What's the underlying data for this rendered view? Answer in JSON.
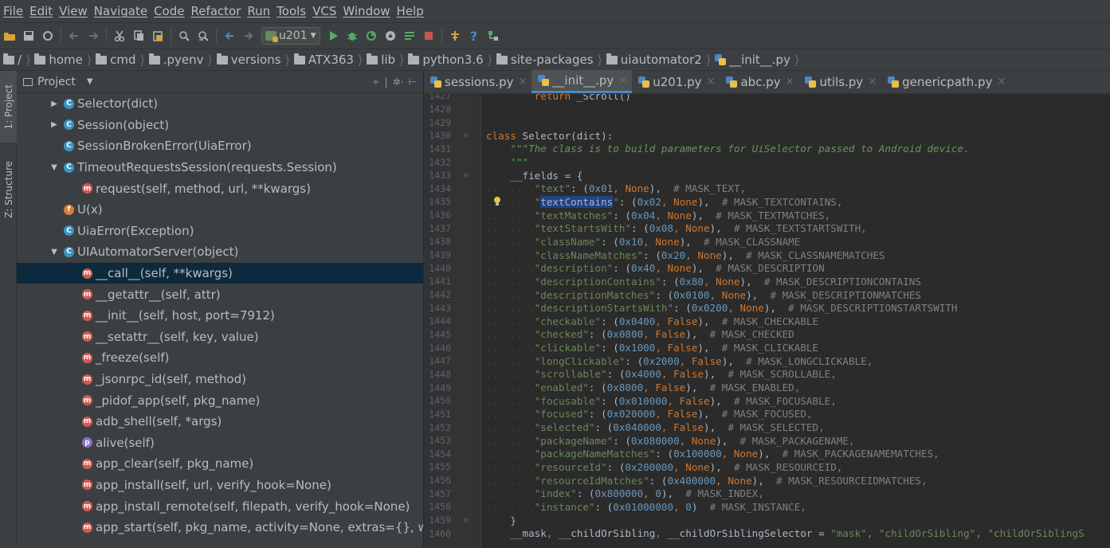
{
  "menu": [
    "File",
    "Edit",
    "View",
    "Navigate",
    "Code",
    "Refactor",
    "Run",
    "Tools",
    "VCS",
    "Window",
    "Help"
  ],
  "toolbar": {
    "run_config": "u201"
  },
  "breadcrumb": [
    "/",
    "home",
    "cmd",
    ".pyenv",
    "versions",
    "ATX363",
    "lib",
    "python3.6",
    "site-packages",
    "uiautomator2",
    "__init__.py"
  ],
  "toolstrip": {
    "project_tab": "1: Project",
    "structure_tab": "Z: Structure"
  },
  "project": {
    "title": "Project",
    "items": [
      {
        "indent": 1,
        "arrow": "▶",
        "kind": "c",
        "badge": "C",
        "label": "Selector(dict)"
      },
      {
        "indent": 1,
        "arrow": "▶",
        "kind": "c",
        "badge": "C",
        "label": "Session(object)"
      },
      {
        "indent": 1,
        "arrow": "",
        "kind": "c",
        "badge": "C",
        "label": "SessionBrokenError(UiaError)"
      },
      {
        "indent": 1,
        "arrow": "▼",
        "kind": "c",
        "badge": "C",
        "label": "TimeoutRequestsSession(requests.Session)"
      },
      {
        "indent": 2,
        "arrow": "",
        "kind": "m",
        "badge": "m",
        "label": "request(self, method, url, **kwargs)"
      },
      {
        "indent": 1,
        "arrow": "",
        "kind": "f",
        "badge": "f",
        "label": "U(x)"
      },
      {
        "indent": 1,
        "arrow": "",
        "kind": "c",
        "badge": "C",
        "label": "UiaError(Exception)"
      },
      {
        "indent": 1,
        "arrow": "▼",
        "kind": "c",
        "badge": "C",
        "label": "UIAutomatorServer(object)"
      },
      {
        "indent": 2,
        "arrow": "",
        "kind": "m",
        "badge": "m",
        "label": "__call__(self, **kwargs)",
        "selected": true
      },
      {
        "indent": 2,
        "arrow": "",
        "kind": "m",
        "badge": "m",
        "label": "__getattr__(self, attr)"
      },
      {
        "indent": 2,
        "arrow": "",
        "kind": "m",
        "badge": "m",
        "label": "__init__(self, host, port=7912)"
      },
      {
        "indent": 2,
        "arrow": "",
        "kind": "m",
        "badge": "m",
        "label": "__setattr__(self, key, value)"
      },
      {
        "indent": 2,
        "arrow": "",
        "kind": "m",
        "badge": "m",
        "label": "_freeze(self)"
      },
      {
        "indent": 2,
        "arrow": "",
        "kind": "m",
        "badge": "m",
        "label": "_jsonrpc_id(self, method)"
      },
      {
        "indent": 2,
        "arrow": "",
        "kind": "m",
        "badge": "m",
        "label": "_pidof_app(self, pkg_name)"
      },
      {
        "indent": 2,
        "arrow": "",
        "kind": "m",
        "badge": "m",
        "label": "adb_shell(self, *args)"
      },
      {
        "indent": 2,
        "arrow": "",
        "kind": "p",
        "badge": "p",
        "label": "alive(self)"
      },
      {
        "indent": 2,
        "arrow": "",
        "kind": "m",
        "badge": "m",
        "label": "app_clear(self, pkg_name)"
      },
      {
        "indent": 2,
        "arrow": "",
        "kind": "m",
        "badge": "m",
        "label": "app_install(self, url, verify_hook=None)"
      },
      {
        "indent": 2,
        "arrow": "",
        "kind": "m",
        "badge": "m",
        "label": "app_install_remote(self, filepath, verify_hook=None)"
      },
      {
        "indent": 2,
        "arrow": "",
        "kind": "m",
        "badge": "m",
        "label": "app_start(self, pkg_name, activity=None, extras={}, wait=T"
      }
    ]
  },
  "tabs": [
    {
      "label": "sessions.py",
      "active": false
    },
    {
      "label": "__init__.py",
      "active": true
    },
    {
      "label": "u201.py",
      "active": false
    },
    {
      "label": "abc.py",
      "active": false
    },
    {
      "label": "utils.py",
      "active": false
    },
    {
      "label": "genericpath.py",
      "active": false
    }
  ],
  "code": [
    {
      "n": "1427",
      "fold": "",
      "t": [
        [
          "ind",
          "        "
        ],
        [
          "kw",
          "return "
        ],
        [
          "cls",
          "_Scroll()"
        ]
      ]
    },
    {
      "n": "1428",
      "fold": "",
      "t": []
    },
    {
      "n": "1429",
      "fold": "",
      "t": []
    },
    {
      "n": "1430",
      "fold": "⊖",
      "t": [
        [
          "kw",
          "class "
        ],
        [
          "cls",
          "Selector(dict):"
        ]
      ]
    },
    {
      "n": "1431",
      "fold": "",
      "t": [
        [
          "ind",
          "    "
        ],
        [
          "doc",
          "\"\"\"The class is to build parameters for UiSelector passed to Android device."
        ]
      ]
    },
    {
      "n": "1432",
      "fold": "",
      "t": [
        [
          "ind",
          "    "
        ],
        [
          "doc",
          "\"\"\""
        ]
      ]
    },
    {
      "n": "1433",
      "fold": "⊖",
      "t": [
        [
          "ind",
          "    "
        ],
        [
          "cls",
          "__fields = {"
        ]
      ]
    },
    {
      "n": "1434",
      "fold": "",
      "t": [
        [
          "ind",
          "........"
        ],
        [
          "str",
          "\"text\""
        ],
        [
          "cls",
          ": ("
        ],
        [
          "num",
          "0x01"
        ],
        [
          "kw",
          ", "
        ],
        [
          "kw",
          "None"
        ],
        [
          "cls",
          "),  "
        ],
        [
          "cmt",
          "# MASK_TEXT,"
        ]
      ]
    },
    {
      "n": "1435",
      "fold": "",
      "bulb": true,
      "t": [
        [
          "ind",
          "........"
        ],
        [
          "str",
          "\""
        ],
        [
          "hl",
          "textContains"
        ],
        [
          "str",
          "\""
        ],
        [
          "cls",
          ": ("
        ],
        [
          "num",
          "0x02"
        ],
        [
          "kw",
          ", "
        ],
        [
          "kw",
          "None"
        ],
        [
          "cls",
          "),  "
        ],
        [
          "cmt",
          "# MASK_TEXTCONTAINS,"
        ]
      ]
    },
    {
      "n": "1436",
      "fold": "",
      "t": [
        [
          "ind",
          "........"
        ],
        [
          "str",
          "\"textMatches\""
        ],
        [
          "cls",
          ": ("
        ],
        [
          "num",
          "0x04"
        ],
        [
          "kw",
          ", "
        ],
        [
          "kw",
          "None"
        ],
        [
          "cls",
          "),  "
        ],
        [
          "cmt",
          "# MASK_TEXTMATCHES,"
        ]
      ]
    },
    {
      "n": "1437",
      "fold": "",
      "t": [
        [
          "ind",
          "........"
        ],
        [
          "str",
          "\"textStartsWith\""
        ],
        [
          "cls",
          ": ("
        ],
        [
          "num",
          "0x08"
        ],
        [
          "kw",
          ", "
        ],
        [
          "kw",
          "None"
        ],
        [
          "cls",
          "),  "
        ],
        [
          "cmt",
          "# MASK_TEXTSTARTSWITH,"
        ]
      ]
    },
    {
      "n": "1438",
      "fold": "",
      "t": [
        [
          "ind",
          "........"
        ],
        [
          "str",
          "\"className\""
        ],
        [
          "cls",
          ": ("
        ],
        [
          "num",
          "0x10"
        ],
        [
          "kw",
          ", "
        ],
        [
          "kw",
          "None"
        ],
        [
          "cls",
          "),  "
        ],
        [
          "cmt",
          "# MASK_CLASSNAME"
        ]
      ]
    },
    {
      "n": "1439",
      "fold": "",
      "t": [
        [
          "ind",
          "........"
        ],
        [
          "str",
          "\"classNameMatches\""
        ],
        [
          "cls",
          ": ("
        ],
        [
          "num",
          "0x20"
        ],
        [
          "kw",
          ", "
        ],
        [
          "kw",
          "None"
        ],
        [
          "cls",
          "),  "
        ],
        [
          "cmt",
          "# MASK_CLASSNAMEMATCHES"
        ]
      ]
    },
    {
      "n": "1440",
      "fold": "",
      "t": [
        [
          "ind",
          "........"
        ],
        [
          "str",
          "\"description\""
        ],
        [
          "cls",
          ": ("
        ],
        [
          "num",
          "0x40"
        ],
        [
          "kw",
          ", "
        ],
        [
          "kw",
          "None"
        ],
        [
          "cls",
          "),  "
        ],
        [
          "cmt",
          "# MASK_DESCRIPTION"
        ]
      ]
    },
    {
      "n": "1441",
      "fold": "",
      "t": [
        [
          "ind",
          "........"
        ],
        [
          "str",
          "\"descriptionContains\""
        ],
        [
          "cls",
          ": ("
        ],
        [
          "num",
          "0x80"
        ],
        [
          "kw",
          ", "
        ],
        [
          "kw",
          "None"
        ],
        [
          "cls",
          "),  "
        ],
        [
          "cmt",
          "# MASK_DESCRIPTIONCONTAINS"
        ]
      ]
    },
    {
      "n": "1442",
      "fold": "",
      "t": [
        [
          "ind",
          "........"
        ],
        [
          "str",
          "\"descriptionMatches\""
        ],
        [
          "cls",
          ": ("
        ],
        [
          "num",
          "0x0100"
        ],
        [
          "kw",
          ", "
        ],
        [
          "kw",
          "None"
        ],
        [
          "cls",
          "),  "
        ],
        [
          "cmt",
          "# MASK_DESCRIPTIONMATCHES"
        ]
      ]
    },
    {
      "n": "1443",
      "fold": "",
      "t": [
        [
          "ind",
          "........"
        ],
        [
          "str",
          "\"descriptionStartsWith\""
        ],
        [
          "cls",
          ": ("
        ],
        [
          "num",
          "0x0200"
        ],
        [
          "kw",
          ", "
        ],
        [
          "kw",
          "None"
        ],
        [
          "cls",
          "),  "
        ],
        [
          "cmt",
          "# MASK_DESCRIPTIONSTARTSWITH"
        ]
      ]
    },
    {
      "n": "1444",
      "fold": "",
      "t": [
        [
          "ind",
          "........"
        ],
        [
          "str",
          "\"checkable\""
        ],
        [
          "cls",
          ": ("
        ],
        [
          "num",
          "0x0400"
        ],
        [
          "kw",
          ", "
        ],
        [
          "kw",
          "False"
        ],
        [
          "cls",
          "),  "
        ],
        [
          "cmt",
          "# MASK_CHECKABLE"
        ]
      ]
    },
    {
      "n": "1445",
      "fold": "",
      "t": [
        [
          "ind",
          "........"
        ],
        [
          "str",
          "\"checked\""
        ],
        [
          "cls",
          ": ("
        ],
        [
          "num",
          "0x0800"
        ],
        [
          "kw",
          ", "
        ],
        [
          "kw",
          "False"
        ],
        [
          "cls",
          "),  "
        ],
        [
          "cmt",
          "# MASK_CHECKED"
        ]
      ]
    },
    {
      "n": "1446",
      "fold": "",
      "t": [
        [
          "ind",
          "........"
        ],
        [
          "str",
          "\"clickable\""
        ],
        [
          "cls",
          ": ("
        ],
        [
          "num",
          "0x1000"
        ],
        [
          "kw",
          ", "
        ],
        [
          "kw",
          "False"
        ],
        [
          "cls",
          "),  "
        ],
        [
          "cmt",
          "# MASK_CLICKABLE"
        ]
      ]
    },
    {
      "n": "1447",
      "fold": "",
      "t": [
        [
          "ind",
          "........"
        ],
        [
          "str",
          "\"longClickable\""
        ],
        [
          "cls",
          ": ("
        ],
        [
          "num",
          "0x2000"
        ],
        [
          "kw",
          ", "
        ],
        [
          "kw",
          "False"
        ],
        [
          "cls",
          "),  "
        ],
        [
          "cmt",
          "# MASK_LONGCLICKABLE,"
        ]
      ]
    },
    {
      "n": "1448",
      "fold": "",
      "t": [
        [
          "ind",
          "........"
        ],
        [
          "str",
          "\"scrollable\""
        ],
        [
          "cls",
          ": ("
        ],
        [
          "num",
          "0x4000"
        ],
        [
          "kw",
          ", "
        ],
        [
          "kw",
          "False"
        ],
        [
          "cls",
          "),  "
        ],
        [
          "cmt",
          "# MASK_SCROLLABLE,"
        ]
      ]
    },
    {
      "n": "1449",
      "fold": "",
      "t": [
        [
          "ind",
          "........"
        ],
        [
          "str",
          "\"enabled\""
        ],
        [
          "cls",
          ": ("
        ],
        [
          "num",
          "0x8000"
        ],
        [
          "kw",
          ", "
        ],
        [
          "kw",
          "False"
        ],
        [
          "cls",
          "),  "
        ],
        [
          "cmt",
          "# MASK_ENABLED,"
        ]
      ]
    },
    {
      "n": "1450",
      "fold": "",
      "t": [
        [
          "ind",
          "........"
        ],
        [
          "str",
          "\"focusable\""
        ],
        [
          "cls",
          ": ("
        ],
        [
          "num",
          "0x010000"
        ],
        [
          "kw",
          ", "
        ],
        [
          "kw",
          "False"
        ],
        [
          "cls",
          "),  "
        ],
        [
          "cmt",
          "# MASK_FOCUSABLE,"
        ]
      ]
    },
    {
      "n": "1451",
      "fold": "",
      "t": [
        [
          "ind",
          "........"
        ],
        [
          "str",
          "\"focused\""
        ],
        [
          "cls",
          ": ("
        ],
        [
          "num",
          "0x020000"
        ],
        [
          "kw",
          ", "
        ],
        [
          "kw",
          "False"
        ],
        [
          "cls",
          "),  "
        ],
        [
          "cmt",
          "# MASK_FOCUSED,"
        ]
      ]
    },
    {
      "n": "1452",
      "fold": "",
      "t": [
        [
          "ind",
          "........"
        ],
        [
          "str",
          "\"selected\""
        ],
        [
          "cls",
          ": ("
        ],
        [
          "num",
          "0x040000"
        ],
        [
          "kw",
          ", "
        ],
        [
          "kw",
          "False"
        ],
        [
          "cls",
          "),  "
        ],
        [
          "cmt",
          "# MASK_SELECTED,"
        ]
      ]
    },
    {
      "n": "1453",
      "fold": "",
      "t": [
        [
          "ind",
          "........"
        ],
        [
          "str",
          "\"packageName\""
        ],
        [
          "cls",
          ": ("
        ],
        [
          "num",
          "0x080000"
        ],
        [
          "kw",
          ", "
        ],
        [
          "kw",
          "None"
        ],
        [
          "cls",
          "),  "
        ],
        [
          "cmt",
          "# MASK_PACKAGENAME,"
        ]
      ]
    },
    {
      "n": "1454",
      "fold": "",
      "t": [
        [
          "ind",
          "........"
        ],
        [
          "str",
          "\"packageNameMatches\""
        ],
        [
          "cls",
          ": ("
        ],
        [
          "num",
          "0x100000"
        ],
        [
          "kw",
          ", "
        ],
        [
          "kw",
          "None"
        ],
        [
          "cls",
          "),  "
        ],
        [
          "cmt",
          "# MASK_PACKAGENAMEMATCHES,"
        ]
      ]
    },
    {
      "n": "1455",
      "fold": "",
      "t": [
        [
          "ind",
          "........"
        ],
        [
          "str",
          "\"resourceId\""
        ],
        [
          "cls",
          ": ("
        ],
        [
          "num",
          "0x200000"
        ],
        [
          "kw",
          ", "
        ],
        [
          "kw",
          "None"
        ],
        [
          "cls",
          "),  "
        ],
        [
          "cmt",
          "# MASK_RESOURCEID,"
        ]
      ]
    },
    {
      "n": "1456",
      "fold": "",
      "t": [
        [
          "ind",
          "........"
        ],
        [
          "str",
          "\"resourceIdMatches\""
        ],
        [
          "cls",
          ": ("
        ],
        [
          "num",
          "0x400000"
        ],
        [
          "kw",
          ", "
        ],
        [
          "kw",
          "None"
        ],
        [
          "cls",
          "),  "
        ],
        [
          "cmt",
          "# MASK_RESOURCEIDMATCHES,"
        ]
      ]
    },
    {
      "n": "1457",
      "fold": "",
      "t": [
        [
          "ind",
          "........"
        ],
        [
          "str",
          "\"index\""
        ],
        [
          "cls",
          ": ("
        ],
        [
          "num",
          "0x800000"
        ],
        [
          "kw",
          ", "
        ],
        [
          "num",
          "0"
        ],
        [
          "cls",
          "),  "
        ],
        [
          "cmt",
          "# MASK_INDEX,"
        ]
      ]
    },
    {
      "n": "1458",
      "fold": "",
      "t": [
        [
          "ind",
          "........"
        ],
        [
          "str",
          "\"instance\""
        ],
        [
          "cls",
          ": ("
        ],
        [
          "num",
          "0x01000000"
        ],
        [
          "kw",
          ", "
        ],
        [
          "num",
          "0"
        ],
        [
          "cls",
          ")  "
        ],
        [
          "cmt",
          "# MASK_INSTANCE,"
        ]
      ]
    },
    {
      "n": "1459",
      "fold": "⊖",
      "t": [
        [
          "ind",
          "    "
        ],
        [
          "cls",
          "}"
        ]
      ]
    },
    {
      "n": "1460",
      "fold": "",
      "t": [
        [
          "ind",
          "    "
        ],
        [
          "cls",
          "__mask"
        ],
        [
          "kw",
          ", "
        ],
        [
          "cls",
          "__childOrSibling"
        ],
        [
          "kw",
          ", "
        ],
        [
          "cls",
          "__childOrSiblingSelector = "
        ],
        [
          "str",
          "\"mask\""
        ],
        [
          "kw",
          ", "
        ],
        [
          "str",
          "\"childOrSibling\""
        ],
        [
          "kw",
          ", "
        ],
        [
          "str",
          "\"childOrSiblingS"
        ]
      ]
    }
  ]
}
